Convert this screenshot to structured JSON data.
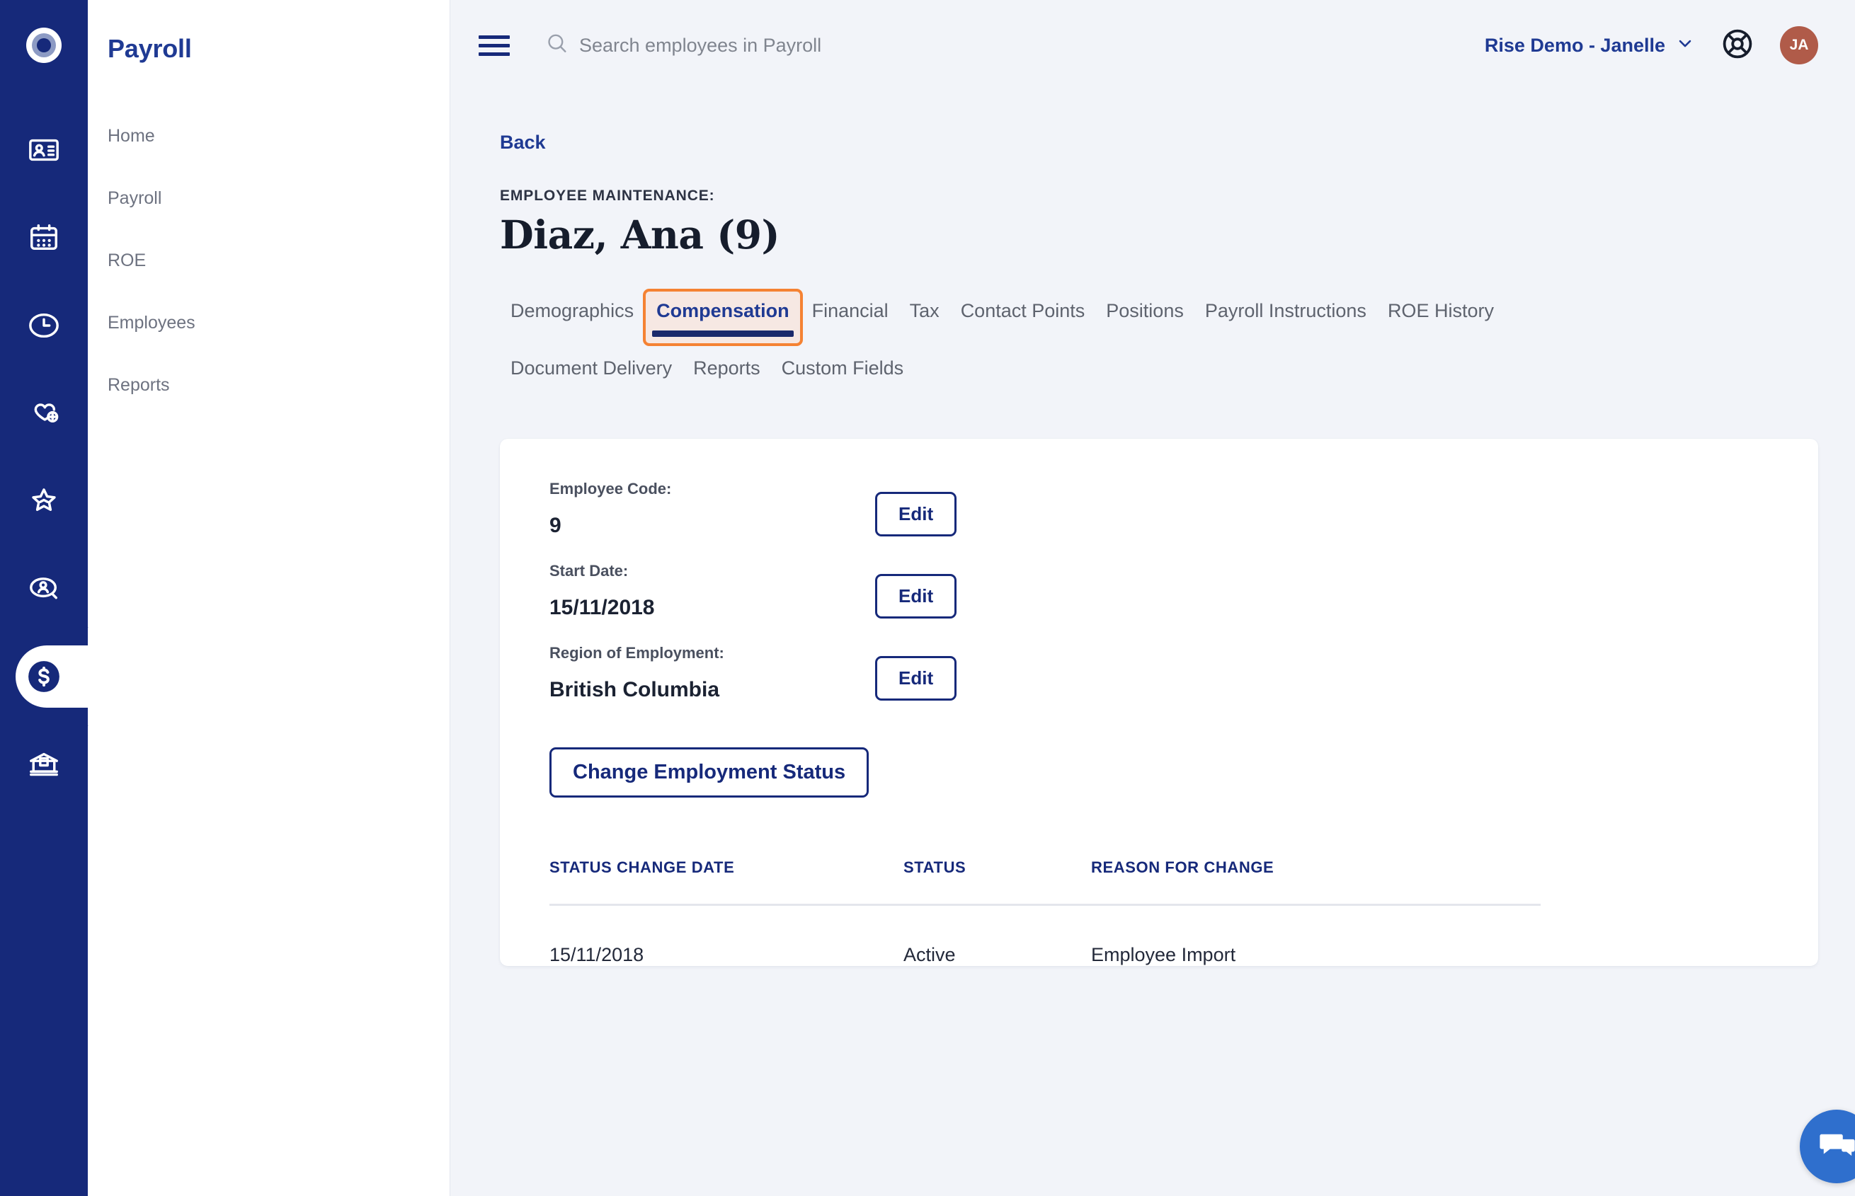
{
  "rail": {
    "logo_icon": "target-circle-logo-icon",
    "items": [
      {
        "name": "contact-card-icon",
        "active": false
      },
      {
        "name": "calendar-icon",
        "active": false
      },
      {
        "name": "clock-icon",
        "active": false
      },
      {
        "name": "heart-plus-icon",
        "active": false
      },
      {
        "name": "star-icon",
        "active": false
      },
      {
        "name": "person-search-icon",
        "active": false
      },
      {
        "name": "dollar-circle-icon",
        "active": true
      },
      {
        "name": "archive-box-icon",
        "active": false
      }
    ]
  },
  "nav": {
    "title": "Payroll",
    "items": [
      {
        "label": "Home"
      },
      {
        "label": "Payroll"
      },
      {
        "label": "ROE"
      },
      {
        "label": "Employees"
      },
      {
        "label": "Reports"
      }
    ]
  },
  "topbar": {
    "menu_icon": "hamburger-menu-icon",
    "search": {
      "icon": "search-icon",
      "placeholder": "Search employees in Payroll",
      "value": ""
    },
    "org_switcher": {
      "label": "Rise Demo - Janelle",
      "chevron_icon": "chevron-down-icon"
    },
    "help_icon": "lifebuoy-help-icon",
    "avatar": {
      "initials": "JA",
      "color": "#b05b49"
    }
  },
  "page": {
    "back_label": "Back",
    "eyebrow": "EMPLOYEE MAINTENANCE:",
    "title": "Diaz, Ana (9)"
  },
  "tabs": [
    {
      "label": "Demographics",
      "active": false
    },
    {
      "label": "Compensation",
      "active": true
    },
    {
      "label": "Financial",
      "active": false
    },
    {
      "label": "Tax",
      "active": false
    },
    {
      "label": "Contact Points",
      "active": false
    },
    {
      "label": "Positions",
      "active": false
    },
    {
      "label": "Payroll Instructions",
      "active": false
    },
    {
      "label": "ROE History",
      "active": false
    },
    {
      "label": "Document Delivery",
      "active": false
    },
    {
      "label": "Reports",
      "active": false
    },
    {
      "label": "Custom Fields",
      "active": false
    }
  ],
  "card": {
    "fields": [
      {
        "label": "Employee Code:",
        "value": "9",
        "edit_label": "Edit"
      },
      {
        "label": "Start Date:",
        "value": "15/11/2018",
        "edit_label": "Edit"
      },
      {
        "label": "Region of Employment:",
        "value": "British Columbia",
        "edit_label": "Edit"
      }
    ],
    "change_status_label": "Change Employment Status",
    "table": {
      "columns": [
        "STATUS CHANGE DATE",
        "STATUS",
        "REASON FOR CHANGE"
      ],
      "rows": [
        [
          "15/11/2018",
          "Active",
          "Employee Import"
        ]
      ]
    }
  },
  "chat": {
    "icon": "chat-bubble-icon",
    "color": "#2f6fcd"
  },
  "colors": {
    "rail_navy": "#16297a",
    "brand_blue": "#1f3a93",
    "accent_orange": "#f58233",
    "tab_active_bg": "#f6e8e3",
    "page_bg": "#f2f4f9"
  }
}
